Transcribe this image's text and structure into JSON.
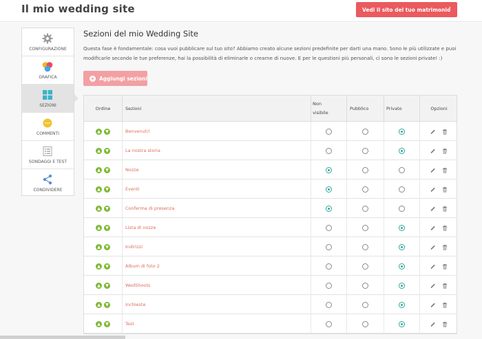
{
  "header": {
    "site_title": "Il mio wedding site",
    "view_button_label": "Vedi il sito del tuo matrimonio",
    "view_button_arrow": "›"
  },
  "sidebar": {
    "items": [
      {
        "label": "CONFIGURAZIONE",
        "icon": "gear-icon"
      },
      {
        "label": "GRAFICA",
        "icon": "palette-icon"
      },
      {
        "label": "SEZIONI",
        "icon": "grid-icon",
        "active": true
      },
      {
        "label": "COMMENTI",
        "icon": "comment-icon"
      },
      {
        "label": "SONDAGGI E TEST",
        "icon": "list-icon"
      },
      {
        "label": "CONDIVIDERE",
        "icon": "share-icon"
      }
    ]
  },
  "main": {
    "title": "Sezioni del mio Wedding Site",
    "intro": "Questa fase è fondamentale: cosa vuoi pubblicare sul tuo sito? Abbiamo creato alcune sezioni predefinite per darti una mano. Sono le più utilizzate e puoi modificarle secondo le tue preferenze, hai la possibilità di eliminarle o crearne di nuove. E per le questioni più personali, ci sono le sezioni private! :)",
    "add_button_label": "Aggiungi sezioni"
  },
  "table": {
    "headers": {
      "ordine": "Ordine",
      "sezioni": "Sezioni",
      "non_visibile_line1": "Non",
      "non_visibile_line2": "visibile",
      "pubblico": "Pubblico",
      "privato": "Privato",
      "opzioni": "Opzioni"
    },
    "rows": [
      {
        "name": "Benvenuti!",
        "visibility": "privato"
      },
      {
        "name": "La nostra storia",
        "visibility": "privato"
      },
      {
        "name": "Nozze",
        "visibility": "non_visibile"
      },
      {
        "name": "Eventi",
        "visibility": "non_visibile"
      },
      {
        "name": "Conferma di presenza",
        "visibility": "non_visibile"
      },
      {
        "name": "Lista di nozze",
        "visibility": "privato"
      },
      {
        "name": "Indirizzi",
        "visibility": "privato"
      },
      {
        "name": "Album di foto 2",
        "visibility": "privato"
      },
      {
        "name": "WedShoots",
        "visibility": "privato"
      },
      {
        "name": "Inchieste",
        "visibility": "privato"
      },
      {
        "name": "Test",
        "visibility": "privato"
      }
    ]
  },
  "colors": {
    "accent": "#ea5a5e",
    "accent_light": "#f2a0a3",
    "order_green": "#7fb833",
    "radio_selected": "#2ea89a",
    "section_link": "#e06a5d"
  }
}
